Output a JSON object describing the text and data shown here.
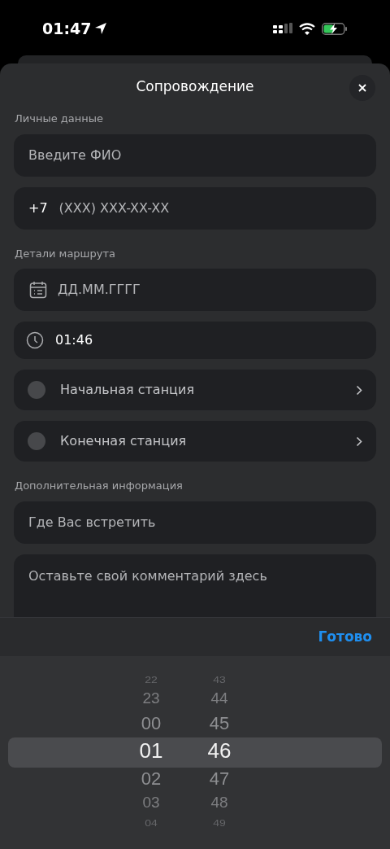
{
  "status_bar": {
    "time": "01:47"
  },
  "sheet": {
    "title": "Сопровождение"
  },
  "sections": [
    {
      "label": "Личные данные",
      "fields": [
        {
          "kind": "text",
          "placeholder": "Введите ФИО"
        },
        {
          "kind": "phone",
          "prefix": "+7",
          "placeholder": "(XXX) XXX-XX-XX"
        }
      ]
    },
    {
      "label": "Детали маршрута",
      "fields": [
        {
          "kind": "date",
          "placeholder": "ДД.ММ.ГГГГ"
        },
        {
          "kind": "time",
          "value": "01:46"
        },
        {
          "kind": "station",
          "label": "Начальная станция"
        },
        {
          "kind": "station",
          "label": "Конечная станция"
        }
      ]
    },
    {
      "label": "Дополнительная информация",
      "fields": [
        {
          "kind": "text",
          "placeholder": "Где Вас встретить"
        },
        {
          "kind": "textarea",
          "placeholder": "Оставьте свой комментарий здесь"
        }
      ]
    }
  ],
  "toolbar": {
    "done": "Готово"
  },
  "picker": {
    "columns": [
      {
        "items": [
          {
            "label": "22",
            "selected": false
          },
          {
            "label": "23",
            "selected": false
          },
          {
            "label": "00",
            "selected": false
          },
          {
            "label": "01",
            "selected": true
          },
          {
            "label": "02",
            "selected": false
          },
          {
            "label": "03",
            "selected": false
          },
          {
            "label": "04",
            "selected": false
          }
        ]
      },
      {
        "items": [
          {
            "label": "43",
            "selected": false
          },
          {
            "label": "44",
            "selected": false
          },
          {
            "label": "45",
            "selected": false
          },
          {
            "label": "46",
            "selected": true
          },
          {
            "label": "47",
            "selected": false
          },
          {
            "label": "48",
            "selected": false
          },
          {
            "label": "49",
            "selected": false
          }
        ]
      }
    ]
  }
}
